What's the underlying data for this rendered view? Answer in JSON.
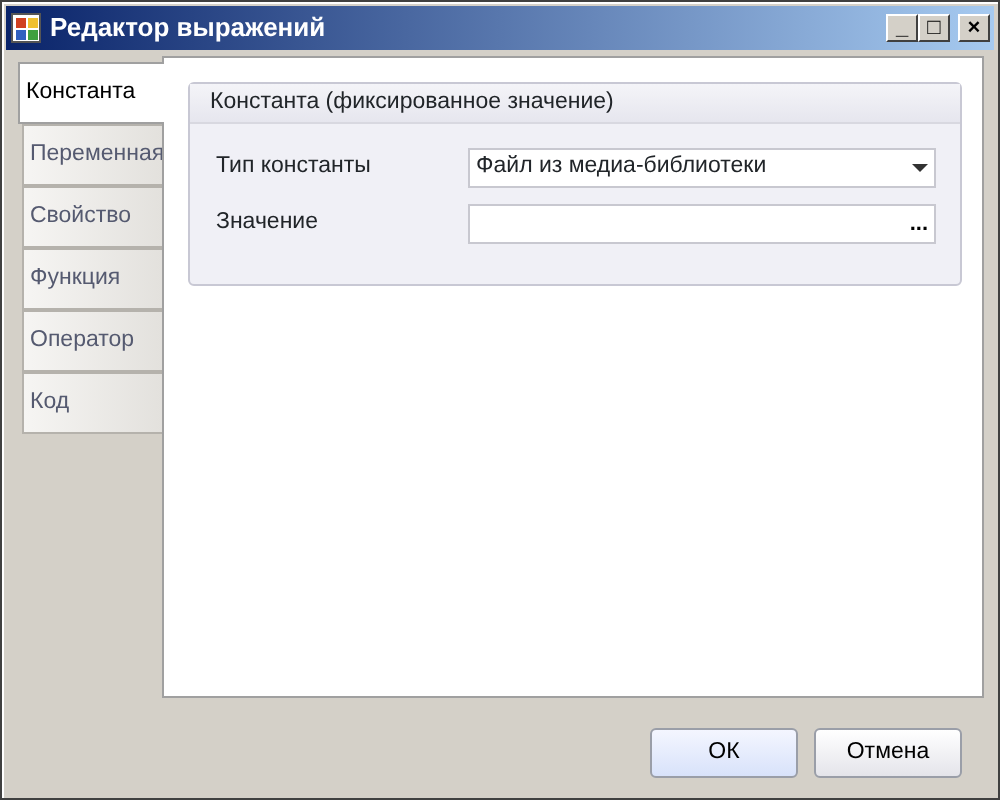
{
  "window": {
    "title": "Редактор выражений",
    "controls": [
      "_",
      "□",
      "×"
    ]
  },
  "tabs": [
    {
      "label": "Константа",
      "selected": true
    },
    {
      "label": "Переменная",
      "selected": false
    },
    {
      "label": "Свойство",
      "selected": false
    },
    {
      "label": "Функция",
      "selected": false
    },
    {
      "label": "Оператор",
      "selected": false
    },
    {
      "label": "Код",
      "selected": false
    }
  ],
  "group": {
    "title": "Константа (фиксированное значение)",
    "fields": [
      {
        "kind": "dropdown",
        "label": "Тип константы",
        "value": "Файл из медиа-библиотеки"
      },
      {
        "kind": "browse",
        "label": "Значение",
        "button": "..."
      }
    ]
  },
  "buttons": [
    "ОК",
    "Отмена"
  ]
}
